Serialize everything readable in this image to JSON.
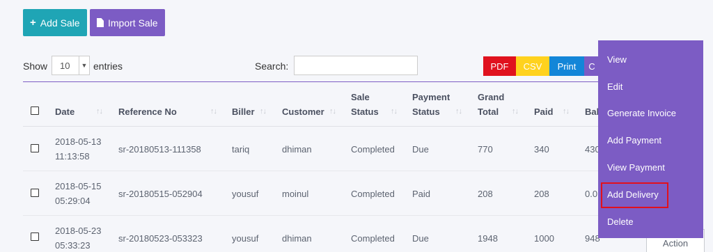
{
  "buttons": {
    "add_sale": "Add Sale",
    "import_sale": "Import Sale"
  },
  "length": {
    "show": "Show",
    "value": "10",
    "entries": "entries"
  },
  "search": {
    "label": "Search:",
    "value": ""
  },
  "export": {
    "pdf": "PDF",
    "csv": "CSV",
    "print": "Print",
    "column": "C"
  },
  "table": {
    "headers": {
      "date": "Date",
      "reference": "Reference No",
      "biller": "Biller",
      "customer": "Customer",
      "sale_status_1": "Sale",
      "sale_status_2": "Status",
      "payment_status_1": "Payment",
      "payment_status_2": "Status",
      "grand_total_1": "Grand",
      "grand_total_2": "Total",
      "paid": "Paid",
      "balance": "Bal"
    },
    "rows": [
      {
        "date_1": "2018-05-13",
        "date_2": "11:13:58",
        "reference": "sr-20180513-111358",
        "biller": "tariq",
        "customer": "dhiman",
        "sale_status": "Completed",
        "payment_status": "Due",
        "grand_total": "770",
        "paid": "340",
        "balance": "430"
      },
      {
        "date_1": "2018-05-15",
        "date_2": "05:29:04",
        "reference": "sr-20180515-052904",
        "biller": "yousuf",
        "customer": "moinul",
        "sale_status": "Completed",
        "payment_status": "Paid",
        "grand_total": "208",
        "paid": "208",
        "balance": "0.0"
      },
      {
        "date_1": "2018-05-23",
        "date_2": "05:33:23",
        "reference": "sr-20180523-053323",
        "biller": "yousuf",
        "customer": "dhiman",
        "sale_status": "Completed",
        "payment_status": "Due",
        "grand_total": "1948",
        "paid": "1000",
        "balance": "948"
      }
    ]
  },
  "action_menu": {
    "items": [
      "View",
      "Edit",
      "Generate Invoice",
      "Add Payment",
      "View Payment",
      "Add Delivery",
      "Delete"
    ],
    "highlighted": "Add Delivery",
    "highlight_color": "#e2101c"
  },
  "action_button": "Action",
  "colors": {
    "accent": "#7c5cc4",
    "teal": "#1fa5b5",
    "pdf": "#e0121e",
    "csv": "#ffd21e",
    "print": "#1386d8"
  }
}
